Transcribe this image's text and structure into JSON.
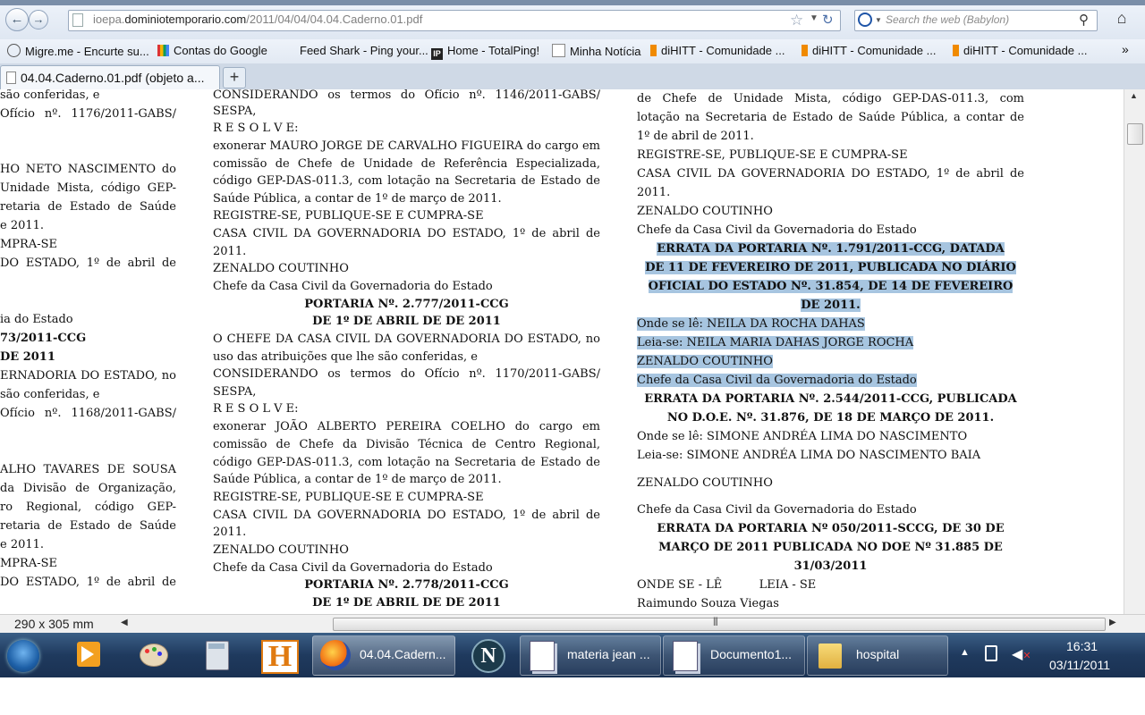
{
  "browser": {
    "url_gray": "ioepa.",
    "url_host": "dominiotemporario.com",
    "url_path": "/2011/04/04/04.04.Caderno.01.pdf",
    "search_placeholder": "Search the web (Babylon)",
    "tab_label": "04.04.Caderno.01.pdf (objeto a...",
    "new_tab": "+",
    "back_glyph": "←",
    "forward_glyph": "→",
    "home_glyph": "⌂",
    "reload_glyph": "↻",
    "star_glyph": "☆",
    "bookmarks": [
      "Migre.me - Encurte su...",
      "Contas do Google",
      "Feed Shark - Ping your...",
      "Home - TotalPing!",
      "Minha Notícia",
      "diHITT - Comunidade ...",
      "diHITT - Comunidade ...",
      "diHITT - Comunidade ..."
    ]
  },
  "document": {
    "col1": [
      "são conferidas, e",
      "Ofício nº. 1176/2011-GABS/",
      "HO NETO NASCIMENTO do",
      "Unidade Mista, código GEP-",
      "retaria de Estado de Saúde",
      "e 2011.",
      "MPRA-SE",
      "DO ESTADO, 1º de abril de",
      "ia do Estado",
      "73/2011-CCG",
      "DE 2011",
      "ERNADORIA DO ESTADO, no",
      "são conferidas, e",
      "Ofício nº. 1168/2011-GABS/",
      "ALHO TAVARES DE SOUSA",
      "da Divisão de Organização,",
      "ro Regional, código GEP-",
      "retaria de Estado de Saúde",
      "e 2011.",
      "MPRA-SE",
      "DO ESTADO, 1º de abril de"
    ],
    "col2": [
      "CONSIDERANDO os termos do Ofício nº. 1146/2011-GABS/",
      "SESPA,",
      "R E S O L V E:",
      "exonerar MAURO JORGE DE CARVALHO FIGUEIRA do cargo em",
      "comissão de Chefe de Unidade de Referência Especializada,",
      "código GEP-DAS-011.3, com lotação na Secretaria de Estado de",
      "Saúde Pública, a contar de 1º de março de 2011.",
      "REGISTRE-SE, PUBLIQUE-SE E CUMPRA-SE",
      "CASA CIVIL DA GOVERNADORIA DO ESTADO, 1º de abril de",
      "2011.",
      "ZENALDO COUTINHO",
      "Chefe da Casa Civil da Governadoria do Estado",
      "PORTARIA Nº. 2.777/2011-CCG",
      "DE 1º DE ABRIL DE DE 2011",
      "O CHEFE DA CASA CIVIL DA GOVERNADORIA DO ESTADO, no",
      "uso das atribuições que lhe são conferidas, e",
      "CONSIDERANDO os termos do Ofício nº. 1170/2011-GABS/",
      "SESPA,",
      "R E S O L V E:",
      "exonerar JOÃO ALBERTO PEREIRA COELHO do cargo em",
      "comissão de Chefe da Divisão Técnica de Centro Regional,",
      "código GEP-DAS-011.3, com lotação na Secretaria de Estado de",
      "Saúde Pública, a contar de 1º de março de 2011.",
      "REGISTRE-SE, PUBLIQUE-SE E CUMPRA-SE",
      "CASA CIVIL DA GOVERNADORIA DO ESTADO, 1º de abril de",
      "2011.",
      "ZENALDO COUTINHO",
      "Chefe da Casa Civil da Governadoria do Estado",
      "PORTARIA Nº. 2.778/2011-CCG",
      "DE 1º DE ABRIL DE DE 2011"
    ],
    "col3": [
      "de Chefe de Unidade Mista, código GEP-DAS-011.3, com",
      "lotação na Secretaria de Estado de Saúde Pública, a contar de",
      "1º de abril de 2011.",
      "REGISTRE-SE, PUBLIQUE-SE E CUMPRA-SE",
      "CASA CIVIL DA GOVERNADORIA DO ESTADO, 1º de abril de",
      "2011.",
      "ZENALDO COUTINHO",
      "Chefe da Casa Civil da Governadoria do Estado",
      "ERRATA DA PORTARIA Nº. 1.791/2011-CCG, DATADA",
      "DE 11 DE FEVEREIRO DE 2011, PUBLICADA NO DIÁRIO",
      "OFICIAL DO ESTADO Nº. 31.854, DE 14 DE FEVEREIRO",
      "DE 2011.",
      "Onde se lê: NEILA DA ROCHA DAHAS",
      "Leia-se: NEILA MARIA DAHAS JORGE ROCHA",
      "ZENALDO COUTINHO",
      "Chefe da Casa Civil da Governadoria do Estado",
      "ERRATA DA PORTARIA Nº. 2.544/2011-CCG, PUBLICADA",
      "NO D.O.E. Nº. 31.876, DE 18 DE MARÇO DE 2011.",
      "Onde se lê: SIMONE ANDRÉA LIMA DO NASCIMENTO",
      "Leia-se: SIMONE ANDRÉA LIMA DO NASCIMENTO BAIA",
      "ZENALDO COUTINHO",
      "Chefe da Casa Civil da Governadoria do Estado",
      "ERRATA DA PORTARIA Nº 050/2011-SCCG,  DE 30 DE",
      "MARÇO DE 2011 PUBLICADA NO DOE Nº 31.885 DE",
      "31/03/2011",
      "ONDE SE - LÊ          LEIA - SE",
      "Raimundo Souza Viegas"
    ]
  },
  "status": {
    "page_size": "290 x 305 mm"
  },
  "taskbar": {
    "buttons": [
      "04.04.Cadern...",
      "materia jean ...",
      "Documento1...",
      "hospital"
    ],
    "time": "16:31",
    "date": "03/11/2011"
  },
  "colors": {
    "selection": "#a7c5e0",
    "taskbar": "#1f3a5e"
  }
}
